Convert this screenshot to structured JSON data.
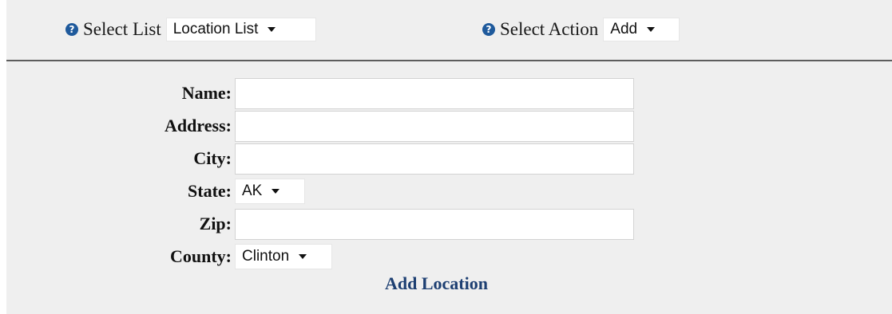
{
  "toolbar": {
    "select_list": {
      "label": "Select List",
      "value": "Location List",
      "icon": "help-icon"
    },
    "select_action": {
      "label": "Select Action",
      "value": "Add",
      "icon": "help-icon"
    }
  },
  "form": {
    "fields": {
      "name": {
        "label": "Name:",
        "value": ""
      },
      "address": {
        "label": "Address:",
        "value": ""
      },
      "city": {
        "label": "City:",
        "value": ""
      },
      "state": {
        "label": "State:",
        "value": "AK"
      },
      "zip": {
        "label": "Zip:",
        "value": ""
      },
      "county": {
        "label": "County:",
        "value": "Clinton"
      }
    },
    "submit_label": "Add Location"
  },
  "colors": {
    "panel_background": "#efefef",
    "divider": "#5d5d5d",
    "help_icon": "#1f5a9c",
    "link": "#1d3f72"
  }
}
